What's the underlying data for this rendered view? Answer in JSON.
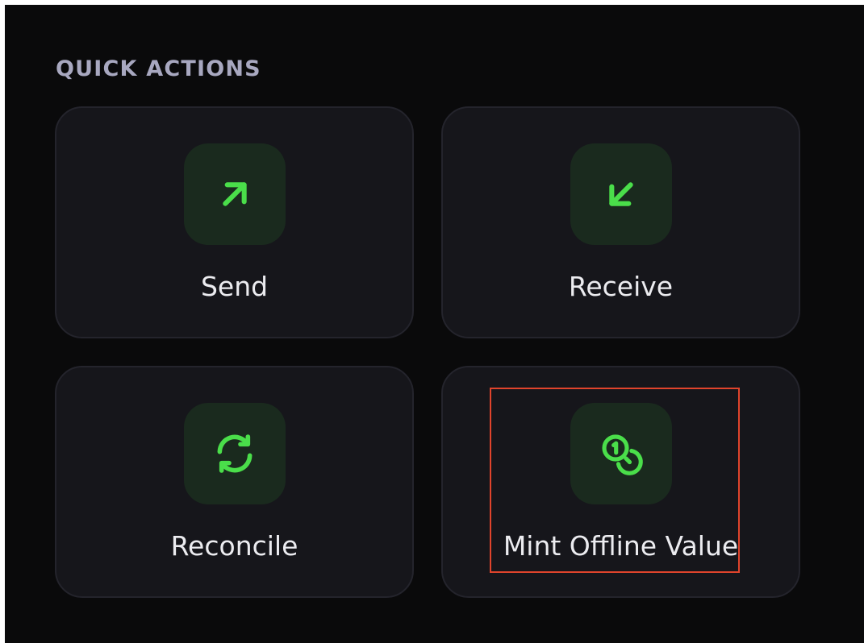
{
  "section": {
    "title": "QUICK ACTIONS"
  },
  "actions": [
    {
      "label": "Send",
      "icon": "arrow-up-right-icon"
    },
    {
      "label": "Receive",
      "icon": "arrow-down-left-icon"
    },
    {
      "label": "Reconcile",
      "icon": "refresh-icon"
    },
    {
      "label": "Mint Offline Value",
      "icon": "coins-icon"
    }
  ],
  "colors": {
    "background": "#0a0a0b",
    "card": "#16161b",
    "card_border": "#24242c",
    "icon_tile": "#1a2a1e",
    "accent_green": "#4ade4a",
    "label_text": "#ececf0",
    "section_title": "#a8a8c0",
    "highlight": "#e0442c"
  }
}
